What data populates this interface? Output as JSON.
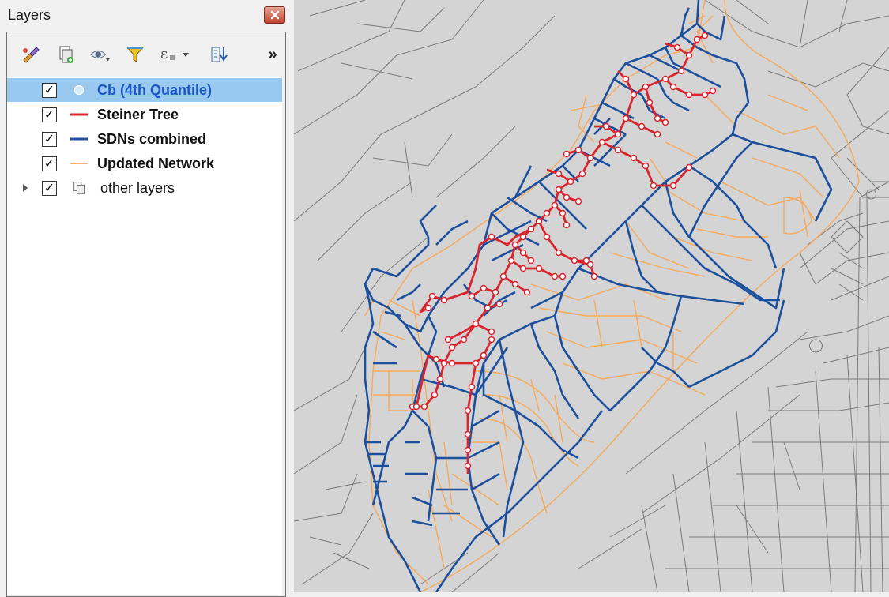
{
  "panel": {
    "title": "Layers",
    "close_icon": "close-icon",
    "toolbar": [
      {
        "name": "open-layer-styling-icon"
      },
      {
        "name": "add-group-icon"
      },
      {
        "name": "manage-visibility-icon"
      },
      {
        "name": "filter-legend-icon"
      },
      {
        "name": "filter-expression-icon"
      },
      {
        "name": "expand-all-icon"
      },
      {
        "name": "more-tools-icon",
        "glyph": "»"
      }
    ]
  },
  "layers": [
    {
      "label": "Cb (4th Quantile)",
      "checked": true,
      "selected": true,
      "symbol": "point",
      "color": "#99c9ef"
    },
    {
      "label": "Steiner Tree",
      "checked": true,
      "symbol": "line",
      "color": "#e0202a"
    },
    {
      "label": "SDNs combined",
      "checked": true,
      "symbol": "line",
      "color": "#1f4f9e"
    },
    {
      "label": "Updated Network",
      "checked": true,
      "symbol": "line",
      "color": "#f7b46a"
    },
    {
      "label": "other layers",
      "checked": true,
      "symbol": "group",
      "collapsed": true
    }
  ],
  "check_glyph": "✓",
  "colors": {
    "map_background": "#d4d4d4",
    "gray_roads": "#7a7a7a",
    "steiner_tree": "#d9232d",
    "sdns_combined": "#1c4f9c",
    "updated_network": "#f5a95a",
    "node_fill": "#ffffff"
  }
}
